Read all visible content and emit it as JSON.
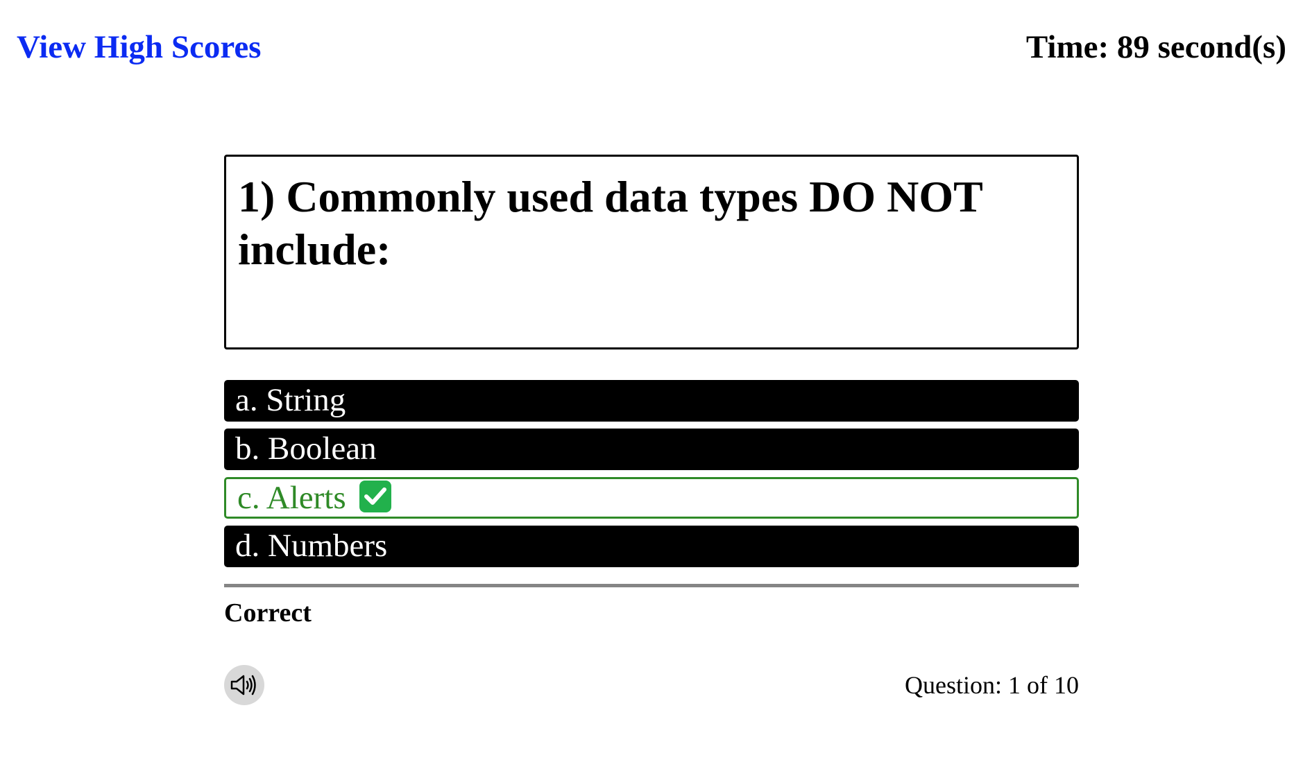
{
  "header": {
    "high_scores_link": "View High Scores",
    "timer": "Time: 89 second(s)"
  },
  "question": {
    "text": "1) Commonly used data types DO NOT include:"
  },
  "answers": [
    {
      "label": "a. String",
      "state": "default"
    },
    {
      "label": "b. Boolean",
      "state": "default"
    },
    {
      "label": "c. Alerts",
      "state": "correct",
      "icon": "check-mark-icon"
    },
    {
      "label": "d. Numbers",
      "state": "default"
    }
  ],
  "feedback": {
    "text": "Correct"
  },
  "footer": {
    "sound_icon": "speaker-icon",
    "question_count": "Question: 1 of 10"
  },
  "colors": {
    "link": "#0b2bf2",
    "answer_background": "#000000",
    "correct": "#2f8a27",
    "check_badge": "#22b14c",
    "divider": "#858585",
    "sound_button": "#d8d8d8"
  }
}
